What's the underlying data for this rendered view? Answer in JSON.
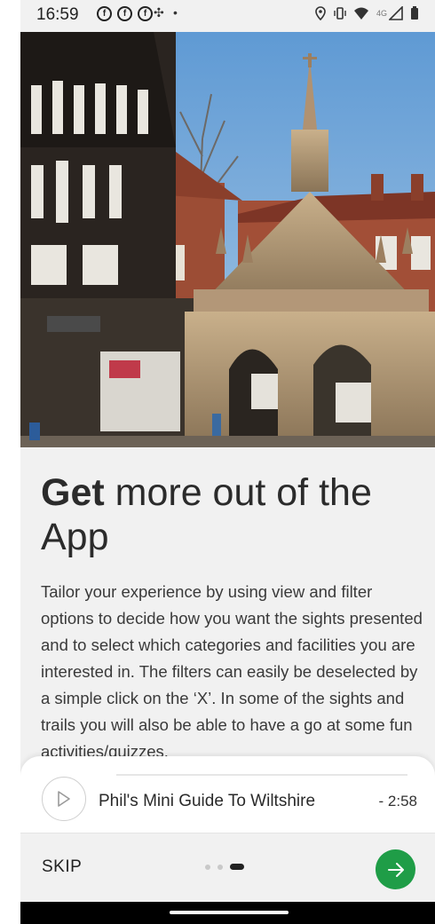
{
  "status_bar": {
    "time": "16:59",
    "left_icons": [
      "notification-icon",
      "notification-icon",
      "notification-icon",
      "fan-icon",
      "dot-icon"
    ],
    "right_icons": [
      "location-icon",
      "vibrate-icon",
      "wifi-icon",
      "signal-icon",
      "battery-icon"
    ],
    "network_label": "4G"
  },
  "hero": {
    "image_description": "Poultry Cross market cross with Tudor timber-framed building under blue sky"
  },
  "content": {
    "headline_bold": "Get",
    "headline_rest": " more out of the App",
    "body": "Tailor your experience by using view and filter options to decide how you want the sights presented and to select which categories and facilities you are interested in. The filters can easily be deselected by a simple click on the ‘X’. In some of the sights and trails you will also be able to have a go at some fun activities/quizzes."
  },
  "player": {
    "title": "Phil's Mini Guide To Wiltshire",
    "time_remaining": "- 2:58"
  },
  "bottom_nav": {
    "skip_label": "SKIP",
    "page_count": 3,
    "active_page": 3,
    "accent_color": "#1f9d47"
  }
}
